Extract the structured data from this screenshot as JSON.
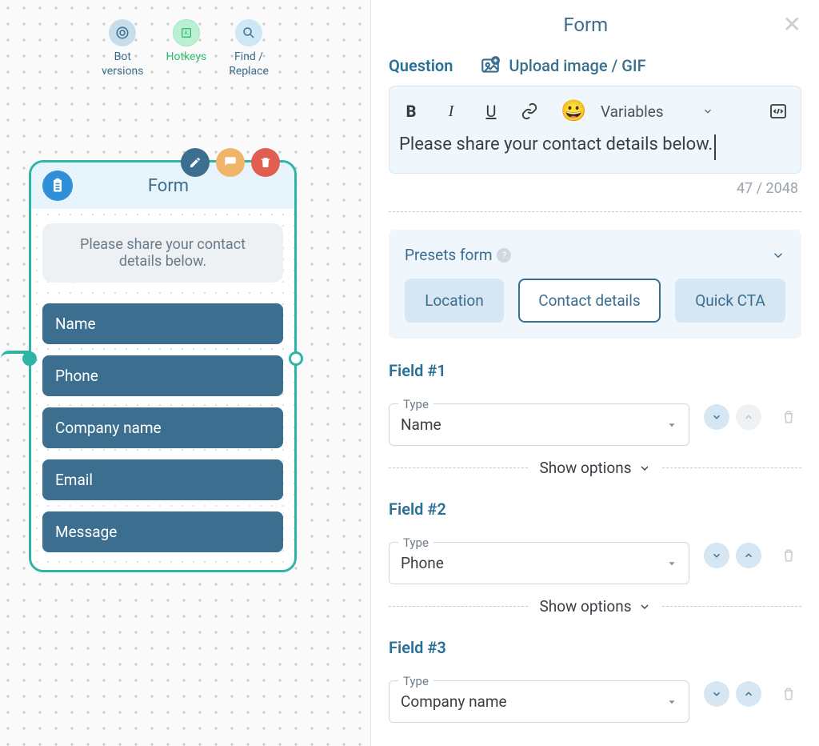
{
  "canvas": {
    "toolbar": [
      {
        "id": "bot-versions",
        "label": "Bot\nversions"
      },
      {
        "id": "hotkeys",
        "label": "Hotkeys"
      },
      {
        "id": "find-replace",
        "label": "Find /\nReplace"
      }
    ],
    "node": {
      "title": "Form",
      "message": "Please share your contact details below.",
      "fields": [
        "Name",
        "Phone",
        "Company name",
        "Email",
        "Message"
      ]
    }
  },
  "panel": {
    "title": "Form",
    "tabs": {
      "question": "Question",
      "upload": "Upload image / GIF"
    },
    "editor": {
      "variables_label": "Variables",
      "text": "Please share your contact details below.",
      "char_count": "47 / 2048"
    },
    "presets": {
      "label": "Presets form",
      "items": [
        "Location",
        "Contact details",
        "Quick CTA"
      ],
      "active": "Contact details"
    },
    "type_label": "Type",
    "show_options": "Show options",
    "fields": [
      {
        "title": "Field #1",
        "type": "Name",
        "up": true,
        "down": false
      },
      {
        "title": "Field #2",
        "type": "Phone",
        "up": true,
        "down": true
      },
      {
        "title": "Field #3",
        "type": "Company name",
        "up": true,
        "down": true
      }
    ]
  }
}
